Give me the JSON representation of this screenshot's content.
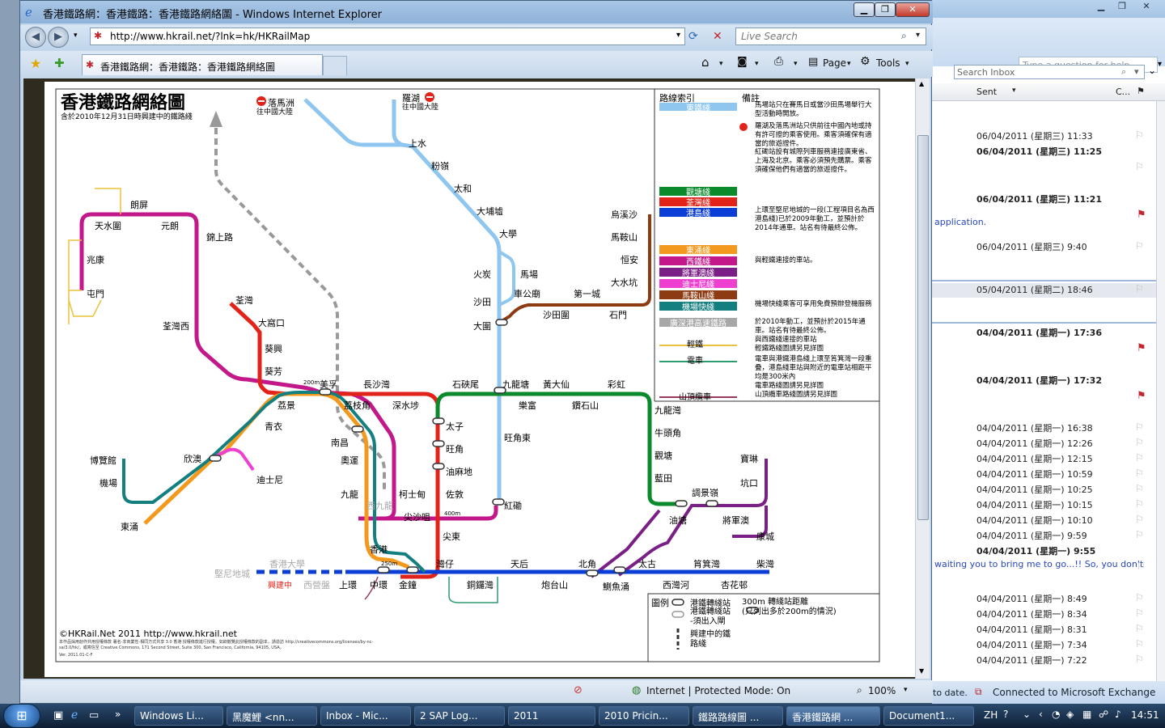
{
  "ie": {
    "window_title": "香港鐵路網：香港鐵路：香港鐵路網絡圖 - Windows Internet Explorer",
    "url": "http://www.hkrail.net/?lnk=hk/HKRailMap",
    "search_placeholder": "Live Search",
    "tab_title": "香港鐵路網：香港鐵路：香港鐵路網絡圖",
    "cmd_page": "Page",
    "cmd_tools": "Tools",
    "status_zone": "Internet | Protected Mode: On",
    "zoom": "100%"
  },
  "map": {
    "title": "香港鐵路網絡圖",
    "subtitle": "含於2010年12月31日時興建中的鐵路綫",
    "legend_header_left": "路線索引",
    "legend_header_right": "備註",
    "lines": [
      {
        "name": "東鐵綫",
        "color": "#8ec6f0"
      },
      {
        "name": "觀塘綫",
        "color": "#0a8a2a"
      },
      {
        "name": "荃灣綫",
        "color": "#e2231a"
      },
      {
        "name": "港島綫",
        "color": "#0a3ed6"
      },
      {
        "name": "東涌綫",
        "color": "#f39a1e"
      },
      {
        "name": "西鐵綫",
        "color": "#c2188a"
      },
      {
        "name": "將軍澳綫",
        "color": "#7a1f85"
      },
      {
        "name": "迪士尼綫",
        "color": "#ef3fd0"
      },
      {
        "name": "馬鞍山綫",
        "color": "#8c3b12"
      },
      {
        "name": "機場快綫",
        "color": "#137f7f"
      },
      {
        "name": "廣深港高速鐵路",
        "color": "#a7a7a7"
      }
    ],
    "notes": [
      "馬場站只在賽馬日或當沙田馬場舉行大型活動時開放。",
      "羅湖及落馬洲站只供前往中國內地或持有許可證的乘客使用。乘客須確保有適當的旅遊證件。",
      "紅磡站設有城際列車服務連接廣東省、上海及北京。乘客必須預先購票。乘客須確保他們有適當的旅遊證件。",
      "上環至堅尼地城的一段(工程項目名為西港島綫)已於2009年動工，並預計於2014年通車。站名有待最終公佈。",
      "與輕鐵連接的車站。",
      "機場快綫乘客可享用免費預辦登機服務",
      "於2010年動工，並預計於2015年通車。站名有待最終公佈。",
      "與西鐵綫連接的車站\n輕鐵路綫圖請另見詳圖",
      "電車與港鐵港島綫上環至筲箕灣一段重疊，港島綫車站與附近的電車站相距平均是300米內\n電車路綫圖請另見詳圖",
      "山頂纜車路綫圖請另見詳圖"
    ],
    "legend_lightrail": "輕鐵",
    "legend_tram": "電車",
    "legend_peak": "山頂纜車",
    "bottom_legend_title": "圖例",
    "bottom_legend": [
      "港鐵轉綫站",
      "港鐵轉綫站\n-須出入閘",
      "興建中的鐵\n路綫",
      "300m 轉綫站距離\n(只列出多於200m的情況)"
    ],
    "under_construction": "興建中",
    "copyright": "©HKRail.Net 2011 http://www.hkrail.net",
    "copyright_small": "本作品採用創作共用授權條款 署名-非商業性-相同方式共享 3.0 香港 授權條款進行授權。如欲觀覽此授權條款的副本，請造訪 http://creativecommons.org/licenses/by-nc-sa/3.0/hk/，或寄信至 Creative Commons, 171 Second Street, Suite 300, San Francisco, California, 94105, USA。",
    "version": "Ver. 2011.01-C-F",
    "stations": {
      "lokmachau": "落馬洲",
      "lokmachau_sub": "往中國大陸",
      "lowu": "羅湖",
      "lowu_sub": "往中國大陸",
      "sheungshui": "上水",
      "fanling": "粉嶺",
      "taiwo": "太和",
      "taipomarket": "大埔墟",
      "university": "大學",
      "fotan": "火炭",
      "racecourse": "馬場",
      "shatin": "沙田",
      "taiwai": "大圍",
      "chekungmiu": "車公廟",
      "shatinwai": "沙田圍",
      "citywon": "第一城",
      "shekmun": "石門",
      "wukaisha": "烏溪沙",
      "maonshan": "馬鞍山",
      "hengon": "恒安",
      "taishuihang": "大水坑",
      "kowloontong": "九龍塘",
      "mongkokeast": "旺角東",
      "hunghom": "紅磡",
      "longping": "朗屏",
      "tinshuiwai": "天水圍",
      "yuenlong": "元朗",
      "kamsheungroad": "錦上路",
      "siuhong": "兆康",
      "tuenmun": "屯門",
      "tsuenwanwest": "荃灣西",
      "tsuenwan": "荃灣",
      "taiwohau": "大窩口",
      "kwaihing": "葵興",
      "kwaifong": "葵芳",
      "laiking": "荔景",
      "meifoo": "美孚",
      "laichikok": "荔枝角",
      "cheungshawan": "長沙灣",
      "shamshuipo": "深水埗",
      "princeedward": "太子",
      "mongkok": "旺角",
      "yaumatei": "油麻地",
      "jordan": "佐敦",
      "tsimshatsui": "尖沙咀",
      "easttsimshatsui": "尖東",
      "austin": "柯士甸",
      "namcheong": "南昌",
      "olympic": "奧運",
      "kowloon": "九龍",
      "westkowloon": "西九龍",
      "tsingyi": "青衣",
      "sunnybay": "欣澳",
      "disney": "迪士尼",
      "asiaworldexpo": "博覽館",
      "airport": "機場",
      "tungchung": "東涌",
      "hongkong": "香港",
      "central": "中環",
      "admiralty": "金鐘",
      "sheungwan": "上環",
      "saiyingpun": "西營盤",
      "hku": "香港大學",
      "kennedytown": "堅尼地城",
      "wanchai": "灣仔",
      "causewaybay": "銅鑼灣",
      "tinhau": "天后",
      "fortresshill": "炮台山",
      "northpoint": "北角",
      "quarrybay": "鰂魚涌",
      "taikoo": "太古",
      "saiwanho": "西灣河",
      "shaukeiwan": "筲箕灣",
      "hengfachuen": "杏花邨",
      "chaiwan": "柴灣",
      "shekkipmei": "石硤尾",
      "lokfu": "樂富",
      "wongtaisin": "黃大仙",
      "diamondhill": "鑽石山",
      "choihung": "彩虹",
      "kowloonbay": "九龍灣",
      "ngautaukok": "牛頭角",
      "kwuntong": "觀塘",
      "lamtin": "藍田",
      "yautong": "油塘",
      "tiukengleng": "調景嶺",
      "tseungkwano": "將軍澳",
      "poalam": "寶琳",
      "hanghau": "坑口",
      "lohaspark": "康城"
    },
    "distance_200m": "200m",
    "distance_400m": "400m",
    "distance_250m": "250m"
  },
  "outlook": {
    "help_placeholder": "Type a question for help",
    "search_placeholder": "Search Inbox",
    "col_sent": "Sent",
    "col_c": "C...",
    "messages": [
      {
        "date": "06/04/2011 (星期三) 11:33",
        "bold": false,
        "flag": "grey"
      },
      {
        "date": "06/04/2011 (星期三) 11:25",
        "bold": true,
        "flag": "grey"
      },
      {
        "date": "06/04/2011 (星期三) 11:21",
        "bold": true,
        "flag": "red"
      },
      {
        "date": "06/04/2011 (星期三) 9:40",
        "bold": false,
        "flag": "grey"
      },
      {
        "date": "05/04/2011 (星期二) 18:46",
        "bold": false,
        "flag": "grey"
      },
      {
        "date": "04/04/2011 (星期一) 17:36",
        "bold": true,
        "flag": "red"
      },
      {
        "date": "04/04/2011 (星期一) 17:32",
        "bold": true,
        "flag": "red"
      },
      {
        "date": "04/04/2011 (星期一) 16:38",
        "bold": false,
        "flag": "grey"
      },
      {
        "date": "04/04/2011 (星期一) 12:26",
        "bold": false,
        "flag": "grey"
      },
      {
        "date": "04/04/2011 (星期一) 12:15",
        "bold": false,
        "flag": "grey"
      },
      {
        "date": "04/04/2011 (星期一) 10:59",
        "bold": false,
        "flag": "grey"
      },
      {
        "date": "04/04/2011 (星期一) 10:25",
        "bold": false,
        "flag": "grey"
      },
      {
        "date": "04/04/2011 (星期一) 10:15",
        "bold": false,
        "flag": "grey"
      },
      {
        "date": "04/04/2011 (星期一) 10:10",
        "bold": false,
        "flag": "grey"
      },
      {
        "date": "04/04/2011 (星期一) 9:59",
        "bold": false,
        "flag": "grey"
      },
      {
        "date": "04/04/2011 (星期一) 9:55",
        "bold": true,
        "flag": "grey"
      },
      {
        "date": "04/04/2011 (星期一) 8:49",
        "bold": false,
        "flag": "grey"
      },
      {
        "date": "04/04/2011 (星期一) 8:34",
        "bold": false,
        "flag": "grey"
      },
      {
        "date": "04/04/2011 (星期一) 8:31",
        "bold": false,
        "flag": "grey"
      },
      {
        "date": "04/04/2011 (星期一) 7:34",
        "bold": false,
        "flag": "grey"
      },
      {
        "date": "04/04/2011 (星期一) 7:22",
        "bold": false,
        "flag": "grey"
      }
    ],
    "preview_1": "application.",
    "preview_2": "waiting you to bring me to go...!! So, you don't",
    "status_left": "to date.",
    "status_right": "Connected to Microsoft Exchange"
  },
  "taskbar": {
    "items": [
      "Windows Li...",
      "黑魔鯉 <nn...",
      "Inbox - Mic...",
      "2 SAP Log...",
      "2011",
      "2010 Pricin...",
      "鐵路路線圖 ...",
      "香港鐵路網 ...",
      "Document1..."
    ],
    "lang": "ZH",
    "clock": "14:51"
  },
  "colors": {
    "ie_blue": "#c4d6ea",
    "map_border": "#333"
  }
}
